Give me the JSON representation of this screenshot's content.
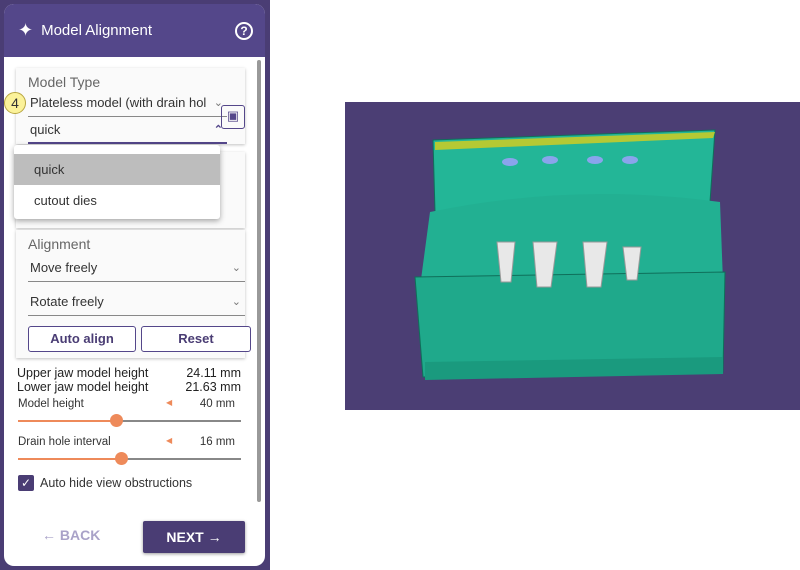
{
  "header": {
    "title": "Model Alignment",
    "help_icon": "question-circle-icon"
  },
  "step_badge": "4",
  "model_type": {
    "label": "Model Type",
    "selected": "Plateless model (with drain hol",
    "sub_selected": "quick",
    "options": [
      "quick",
      "cutout dies"
    ]
  },
  "alignment": {
    "label": "Alignment",
    "move": "Move freely",
    "rotate": "Rotate freely",
    "auto_align": "Auto align",
    "reset": "Reset"
  },
  "measurements": [
    {
      "label": "Upper jaw model height",
      "value": "24.11 mm"
    },
    {
      "label": "Lower jaw model height",
      "value": "21.63 mm"
    }
  ],
  "sliders": [
    {
      "label": "Model height",
      "value": "40 mm",
      "fraction": 0.44
    },
    {
      "label": "Drain hole interval",
      "value": "16 mm",
      "fraction": 0.46
    }
  ],
  "checkbox": {
    "label": "Auto hide view obstructions",
    "checked": true
  },
  "nav": {
    "back": "BACK",
    "next": "NEXT"
  },
  "colors": {
    "accent": "#54478a",
    "slider": "#ee8a5a",
    "viewport": "#4b3e74",
    "model": "#1fb394"
  }
}
